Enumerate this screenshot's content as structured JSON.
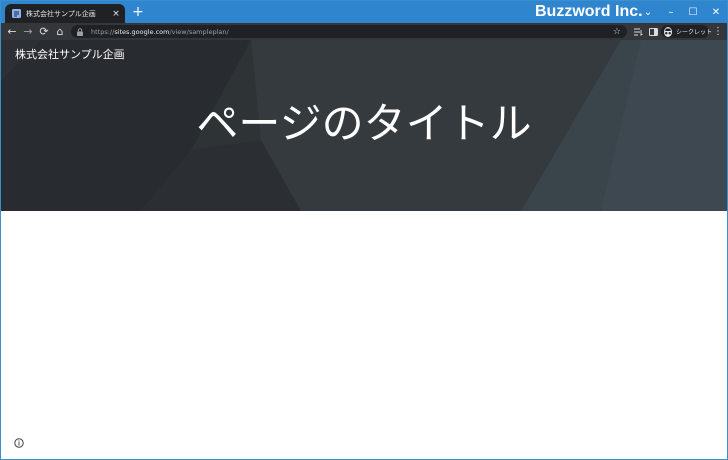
{
  "browser": {
    "tab": {
      "title": "株式会社サンプル企画",
      "favicon": "sites-icon",
      "close_symbol": "×"
    },
    "new_tab_symbol": "+",
    "brand": "Buzzword Inc.",
    "window_controls": {
      "dropdown": "⌄",
      "minimize": "–",
      "maximize": "☐",
      "close": "✕"
    },
    "toolbar": {
      "back": "←",
      "forward": "→",
      "reload": "⟳",
      "home": "⌂",
      "url_scheme": "https://",
      "url_host": "sites.google.com",
      "url_path": "/view/sampleplan/",
      "bookmark_symbol": "☆",
      "incognito_label": "シークレット",
      "menu_symbol": "⋮"
    }
  },
  "page": {
    "site_name": "株式会社サンプル企画",
    "title": "ページのタイトル"
  },
  "colors": {
    "titlebar": "#2f86cf",
    "toolbar": "#35363a",
    "tab": "#202124",
    "hero": "#2b3034"
  }
}
